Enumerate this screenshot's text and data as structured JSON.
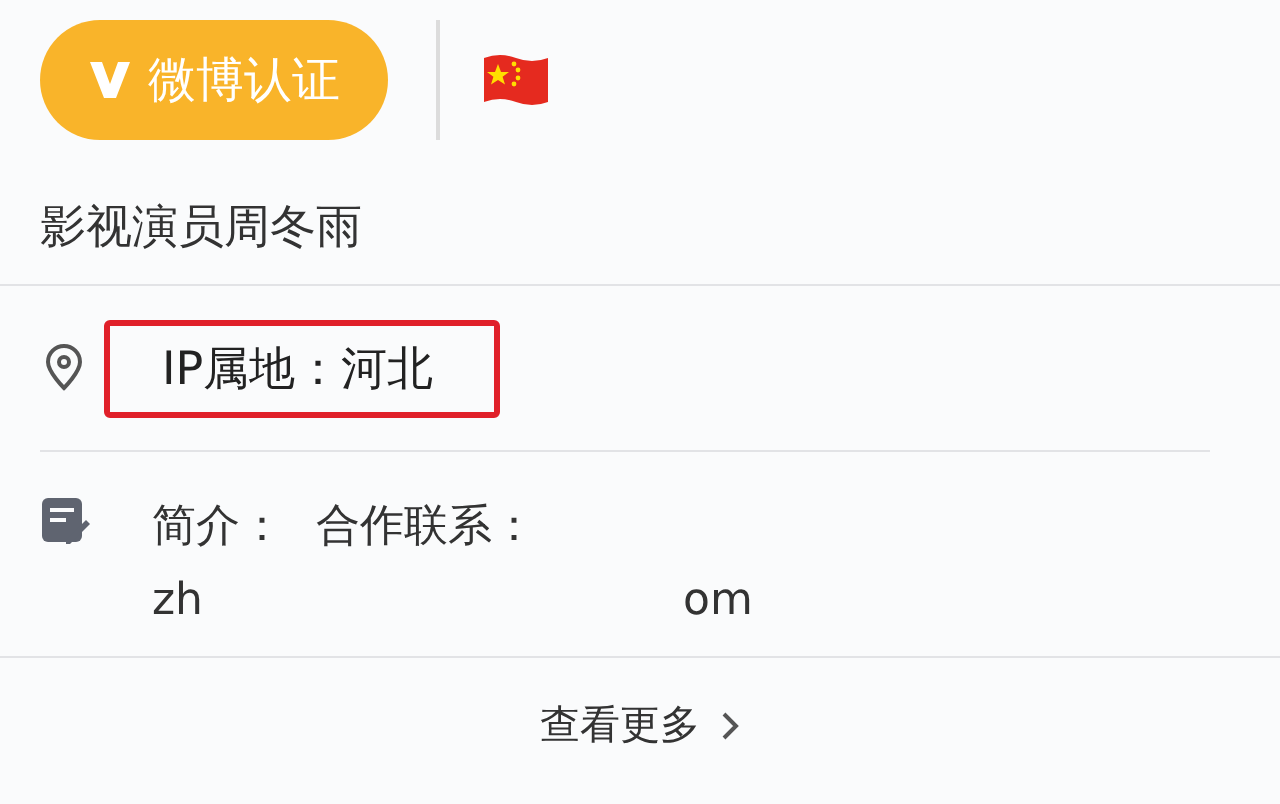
{
  "badge": {
    "label": "微博认证"
  },
  "description": "影视演员周冬雨",
  "ip_location": {
    "text": "IP属地：河北",
    "highlighted": true
  },
  "intro": {
    "label": "简介：",
    "text": "合作联系：",
    "email_parts": [
      "zh",
      "om"
    ]
  },
  "more_link": {
    "label": "查看更多"
  }
}
